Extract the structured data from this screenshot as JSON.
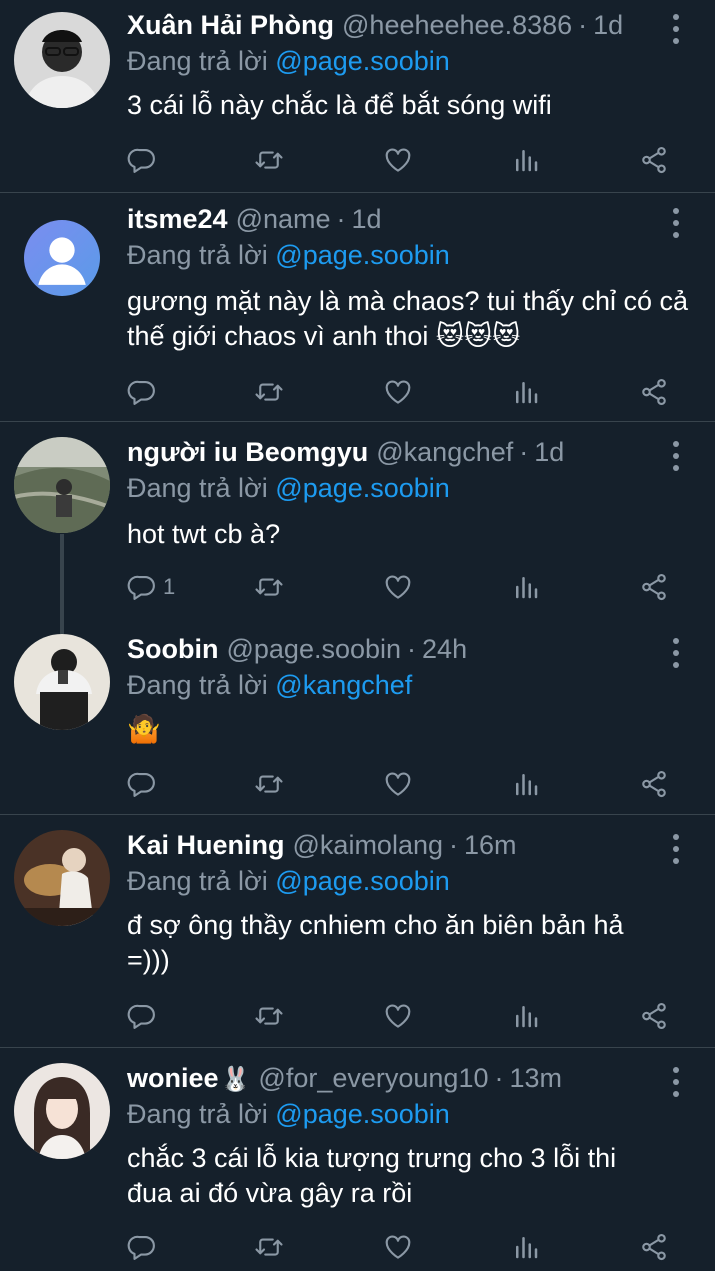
{
  "reply_prefix": "Đang trả lời",
  "tweets": [
    {
      "name": "Xuân Hải Phòng",
      "handle": "@heeheehee.8386",
      "dot": "·",
      "time": "1d",
      "reply_to": "@page.soobin",
      "text": "3 cái lỗ này chắc là để bắt sóng wifi",
      "reply_count": ""
    },
    {
      "name": "itsme24",
      "handle": "@name",
      "dot": "·",
      "time": "1d",
      "reply_to": "@page.soobin",
      "text": "gương mặt này là mà chaos? tui thấy chỉ có cả thế giới chaos vì anh thoi 😻😻😻",
      "reply_count": ""
    },
    {
      "name": "người iu Beomgyu",
      "handle": "@kangchef",
      "dot": "·",
      "time": "1d",
      "reply_to": "@page.soobin",
      "text": "hot twt cb à?",
      "reply_count": "1"
    },
    {
      "name": "Soobin",
      "handle": "@page.soobin",
      "dot": "·",
      "time": "24h",
      "reply_to": "@kangchef",
      "text": "🤷",
      "reply_count": ""
    },
    {
      "name": "Kai Huening",
      "handle": "@kaimolang",
      "dot": "·",
      "time": "16m",
      "reply_to": "@page.soobin",
      "text": "đ sợ ông thầy cnhiem cho ăn biên bản hả =)))",
      "reply_count": ""
    },
    {
      "name": "woniee",
      "name_emoji": "🐰",
      "handle": "@for_everyoung10",
      "dot": "·",
      "time": "13m",
      "reply_to": "@page.soobin",
      "text": "chắc 3 cái lỗ kia tượng trưng cho 3 lỗi thi đua ai đó vừa gây ra rồi",
      "reply_count": ""
    }
  ],
  "colors": {
    "background": "#15202b",
    "text": "#ffffff",
    "secondary": "#8b98a5",
    "accent": "#1d9bf0",
    "border": "#38444d"
  },
  "icons": [
    "more-vertical-icon",
    "reply-icon",
    "retweet-icon",
    "like-icon",
    "views-icon",
    "share-icon"
  ]
}
